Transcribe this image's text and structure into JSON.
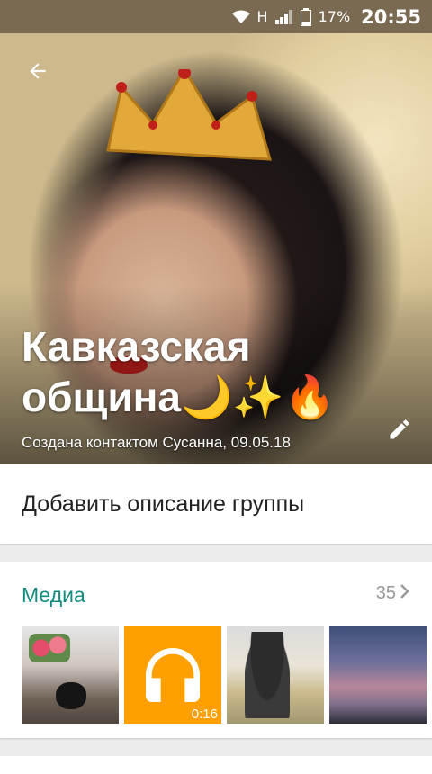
{
  "status_bar": {
    "network": "H",
    "battery": "17%",
    "time": "20:55"
  },
  "header": {
    "title": "Кавказская община🌙✨🔥",
    "subtitle": "Создана контактом Сусанна, 09.05.18"
  },
  "description": {
    "placeholder": "Добавить описание группы"
  },
  "media": {
    "title": "Медиа",
    "count": "35",
    "items": [
      {
        "type": "photo"
      },
      {
        "type": "audio",
        "duration": "0:16"
      },
      {
        "type": "photo"
      },
      {
        "type": "photo"
      }
    ]
  },
  "colors": {
    "accent": "#128c7e",
    "status_bar": "#7a6a52",
    "audio_tile": "#ffa000"
  }
}
